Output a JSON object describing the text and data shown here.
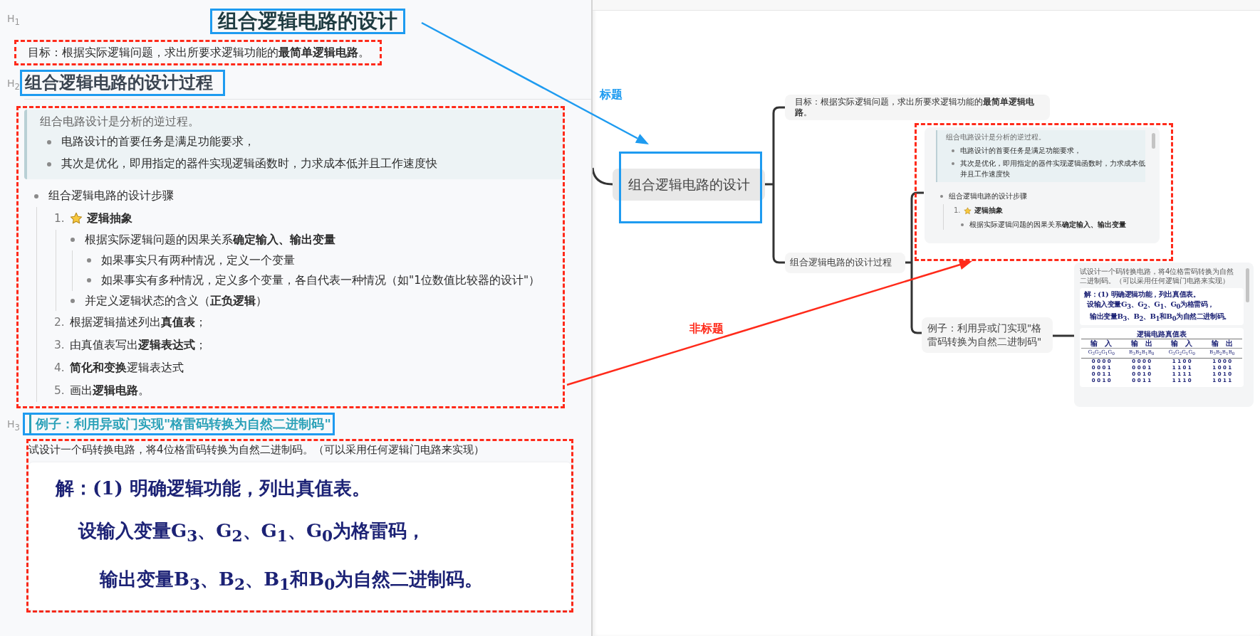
{
  "editor": {
    "h1": {
      "level_label": "H$_{1}$",
      "text": "组合逻辑电路的设计",
      "highlighted": true
    },
    "goal": {
      "text": "目标：根据实际逻辑问题，求出所要求逻辑功能的**最简单逻辑电路**。",
      "outlined": true
    },
    "h2": {
      "level_label": "H$_{2}$",
      "text": "组合逻辑电路的设计过程",
      "highlighted": true
    },
    "process": {
      "outlined": true,
      "blockquote": {
        "lead": "组合电路设计是分析的逆过程。",
        "bullets": [
          "电路设计的首要任务是满足功能要求，",
          "其次是优化，即用指定的器件实现逻辑函数时，力求成本低并且工作速度快"
        ]
      },
      "list": {
        "text": "组合逻辑电路的设计步骤",
        "steps": [
          {
            "number": "1.",
            "star": true,
            "text": "**逻辑抽象**",
            "children": [
              {
                "text": "根据实际逻辑问题的因果关系**确定输入、输出变量**",
                "children": [
                  {
                    "text": "如果事实只有两种情况，定义一个变量"
                  },
                  {
                    "text": "如果事实有多种情况，定义多个变量，各自代表一种情况（如\"1位数值比较器的设计\"）"
                  }
                ]
              },
              {
                "text": "并定义逻辑状态的含义（**正负逻辑**）"
              }
            ]
          },
          {
            "number": "2.",
            "star": false,
            "text": "根据逻辑描述列出**真值表**；"
          },
          {
            "number": "3.",
            "star": false,
            "text": "由真值表写出**逻辑表达式**；"
          },
          {
            "number": "4.",
            "star": false,
            "text": "**简化和变换**逻辑表达式"
          },
          {
            "number": "5.",
            "star": false,
            "text": "画出**逻辑电路**。"
          }
        ]
      }
    },
    "h3": {
      "level_label": "H$_{3}$",
      "text": "例子：利用异或门实现\"格雷码转换为自然二进制码\"",
      "highlighted": true
    },
    "example": {
      "outlined": true,
      "question": "试设计一个码转换电路，将4位格雷码转换为自然二进制码。（可以采用任何逻辑门电路来实现）",
      "solution": [
        "解：(1) 明确逻辑功能，列出真值表。",
        "设输入变量G$_{3}$、G$_{2}$、G$_{1}$、G$_{0}$为格雷码，",
        "输出变量B$_{3}$、B$_{2}$、B$_{1}$和B$_{0}$为自然二进制码。"
      ]
    }
  },
  "mindmap": {
    "root": {
      "text": "组合逻辑电路的设计",
      "highlighted": true
    },
    "goal": {
      "text": "目标：根据实际逻辑问题，求出所要求逻辑功能的**最简单逻辑电路**。"
    },
    "process": {
      "text": "组合逻辑电路的设计过程",
      "preview": {
        "outlined": true,
        "lead": "组合电路设计是分析的逆过程。",
        "bullets": [
          "电路设计的首要任务是满足功能要求，",
          "其次是优化，即用指定的器件实现逻辑函数时，力求成本低并且工作速度快"
        ],
        "list_text": "组合逻辑电路的设计步骤",
        "step_number": "1.",
        "step_star": true,
        "step_text": "**逻辑抽象**",
        "sub_bullet": "根据实际逻辑问题的因果关系**确定输入、输出变量**"
      }
    },
    "example": {
      "text": "例子：利用异或门实现\"格雷码转换为自然二进制码\"",
      "preview": {
        "question": "试设计一个码转换电路，将4位格雷码转换为自然二进制码。（可以采用任何逻辑门电路来实现）",
        "solution": [
          "解：(1) 明确逻辑功能，列出真值表。",
          "设输入变量G$_{3}$、G$_{2}$、G$_{1}$、G$_{0}$为格雷码，",
          "输出变量B$_{3}$、B$_{2}$、B$_{1}$和B$_{0}$为自然二进制码。"
        ],
        "table": {
          "title": "逻辑电路真值表",
          "headers": [
            "输　入",
            "输　出",
            "输　入",
            "输　出"
          ],
          "subheaders": [
            "G$_{3}$G$_{2}$G$_{1}$G$_{0}$",
            "B$_{3}$B$_{2}$B$_{1}$B$_{0}$",
            "G$_{3}$G$_{2}$G$_{1}$G$_{0}$",
            "B$_{3}$B$_{2}$B$_{1}$B$_{0}$"
          ],
          "rows": [
            [
              "0 0 0 0",
              "0 0 0 0",
              "1 1 0 0",
              "1 0 0 0"
            ],
            [
              "0 0 0 1",
              "0 0 0 1",
              "1 1 0 1",
              "1 0 0 1"
            ],
            [
              "0 0 1 1",
              "0 0 1 0",
              "1 1 1 1",
              "1 0 1 0"
            ],
            [
              "0 0 1 0",
              "0 0 1 1",
              "1 1 1 0",
              "1 0 1 1"
            ]
          ]
        }
      }
    }
  },
  "annotations": [
    {
      "kind": "title",
      "label": "标题"
    },
    {
      "kind": "non_title",
      "label": "非标题"
    }
  ]
}
